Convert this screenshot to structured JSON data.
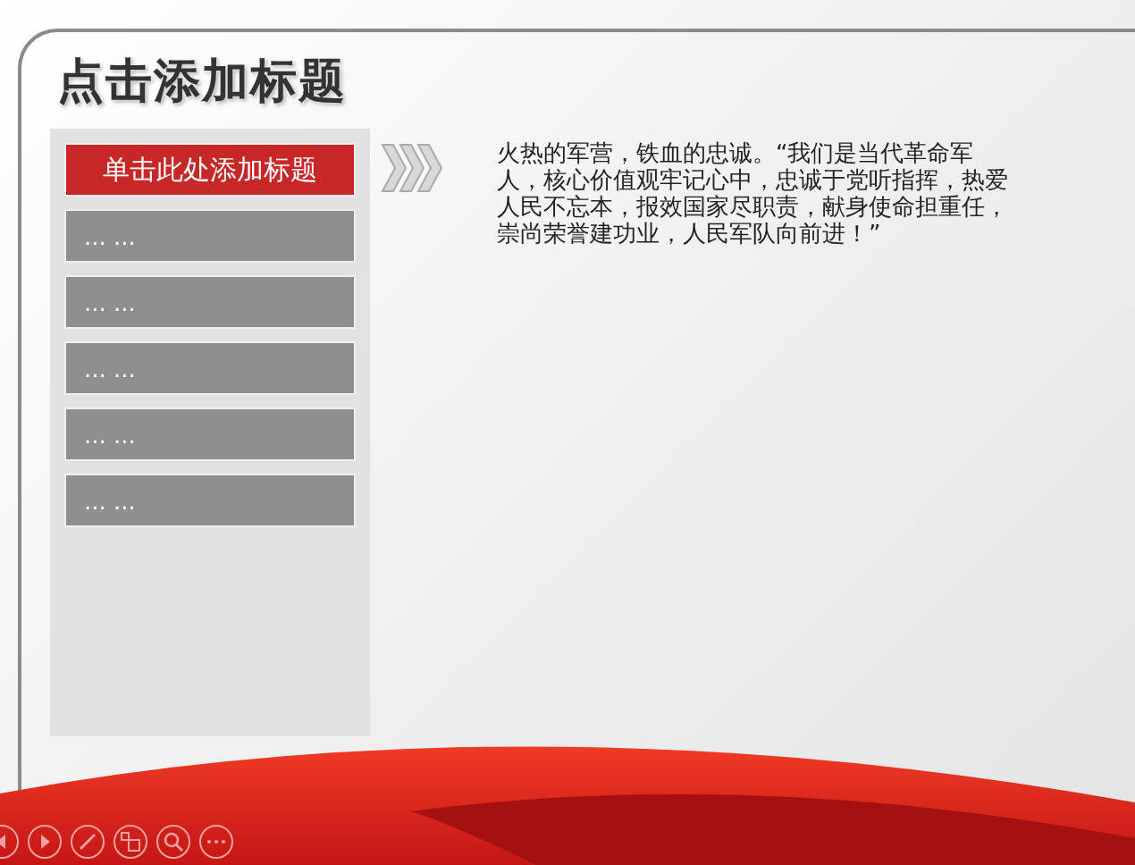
{
  "title": "点击添加标题",
  "menu": [
    {
      "label": "单击此处添加标题",
      "selected": true
    },
    {
      "label": "... ...",
      "selected": false
    },
    {
      "label": "... ...",
      "selected": false
    },
    {
      "label": "... ...",
      "selected": false
    },
    {
      "label": "... ...",
      "selected": false
    },
    {
      "label": "... ...",
      "selected": false
    }
  ],
  "body": "火热的军营，铁血的忠诚。“我们是当代革命军人，核心价值观牢记心中，忠诚于党听指挥，热爱人民不忘本，报效国家尽职责，献身使命担重任，崇尚荣誉建功业，人民军队向前进！”",
  "toolbar": [
    {
      "kind": "prev"
    },
    {
      "kind": "next"
    },
    {
      "kind": "pen"
    },
    {
      "kind": "slides"
    },
    {
      "kind": "zoom"
    },
    {
      "kind": "more"
    }
  ]
}
